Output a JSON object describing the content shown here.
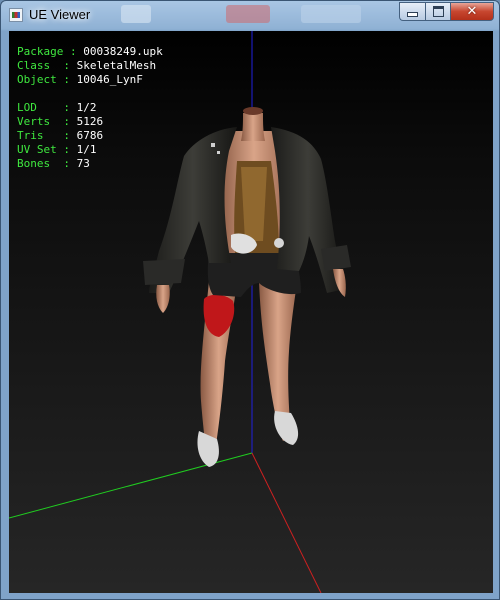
{
  "window": {
    "title": "UE Viewer"
  },
  "info": {
    "package_label": "Package",
    "package_value": "00038249.upk",
    "class_label": "Class  ",
    "class_value": "SkeletalMesh",
    "object_label": "Object ",
    "object_value": "10046_LynF",
    "lod_label": "LOD    ",
    "lod_value": "1/2",
    "verts_label": "Verts  ",
    "verts_value": "5126",
    "tris_label": "Tris   ",
    "tris_value": "6786",
    "uvset_label": "UV Set ",
    "uvset_value": "1/1",
    "bones_label": "Bones  ",
    "bones_value": "73"
  },
  "colors": {
    "info_label": "#3fe83f",
    "info_value": "#ffffff",
    "axis_x": "#cc2020",
    "axis_y": "#20cc20",
    "axis_z": "#2020dd"
  },
  "icons": {
    "app": "ue-viewer-app-icon",
    "minimize": "minimize-icon",
    "maximize": "maximize-icon",
    "close": "close-icon"
  }
}
